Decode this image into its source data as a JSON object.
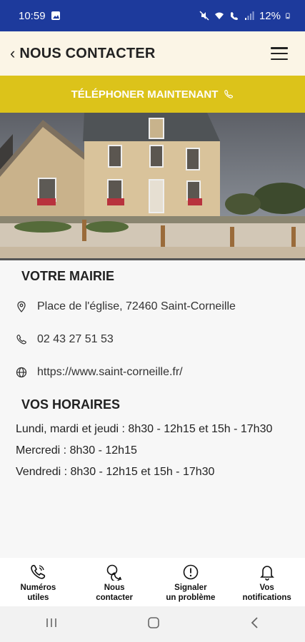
{
  "status_bar": {
    "time": "10:59",
    "battery": "12%"
  },
  "header": {
    "title": "NOUS CONTACTER"
  },
  "call_button": {
    "label": "TÉLÉPHONER MAINTENANT"
  },
  "mairie": {
    "title": "VOTRE MAIRIE",
    "address": "Place de l'église, 72460 Saint-Corneille",
    "phone": "02 43 27 51 53",
    "website": "https://www.saint-corneille.fr/"
  },
  "horaires": {
    "title": "VOS HORAIRES",
    "lines": [
      "Lundi, mardi et jeudi : 8h30 - 12h15 et 15h - 17h30",
      "Mercredi : 8h30 - 12h15",
      "Vendredi : 8h30 - 12h15 et 15h - 17h30"
    ]
  },
  "bottom_nav": [
    {
      "label": "Numéros\nutiles",
      "icon": "phone-icon"
    },
    {
      "label": "Nous\ncontacter",
      "icon": "chat-bubbles-icon"
    },
    {
      "label": "Signaler\nun problème",
      "icon": "alert-circle-icon"
    },
    {
      "label": "Vos\nnotifications",
      "icon": "bell-icon"
    }
  ],
  "colors": {
    "status_bar": "#1d3a9c",
    "header_bg": "#fbf5e6",
    "accent": "#dcc31a"
  }
}
